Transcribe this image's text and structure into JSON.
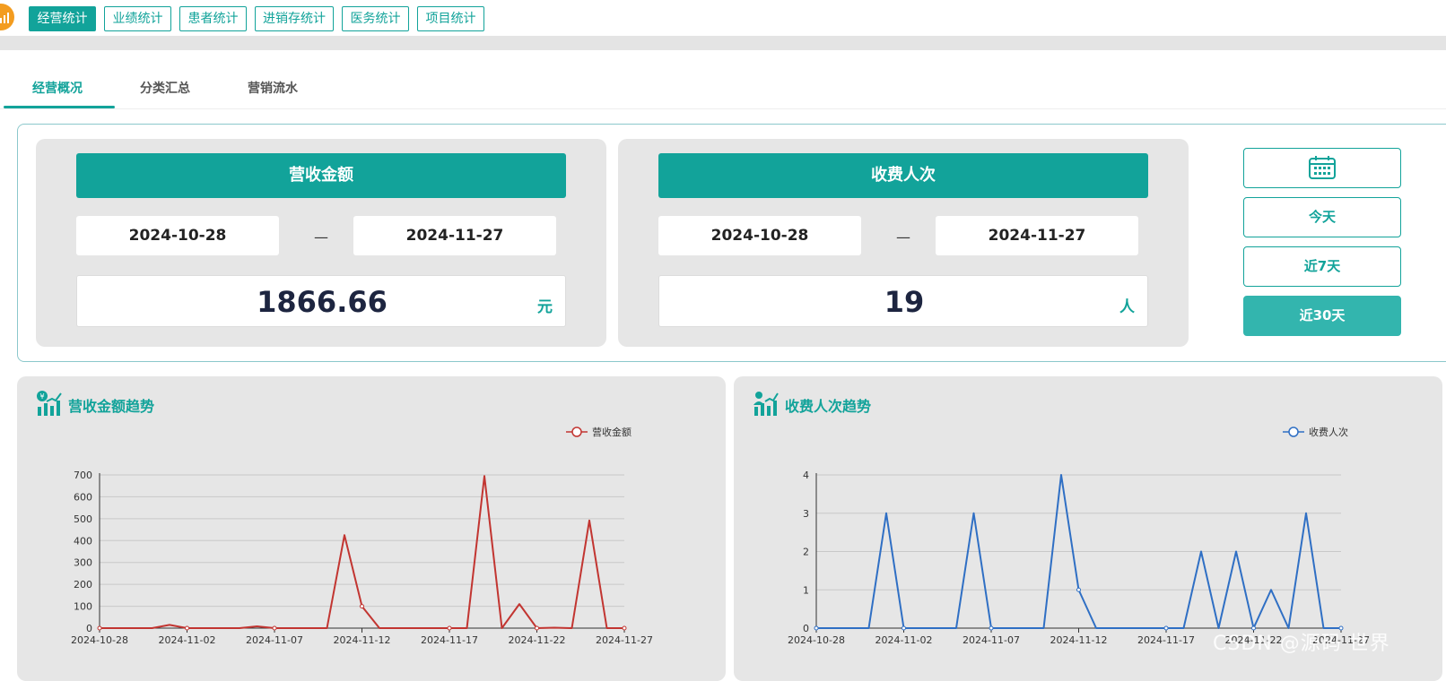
{
  "top_tabs": [
    "经营统计",
    "业绩统计",
    "患者统计",
    "进销存统计",
    "医务统计",
    "项目统计"
  ],
  "sub_tabs": [
    "经营概况",
    "分类汇总",
    "营销流水"
  ],
  "revenue_card": {
    "title": "营收金额",
    "start_date": "2024-10-28",
    "end_date": "2024-11-27",
    "separator": "—",
    "value": "1866.66",
    "unit": "元"
  },
  "visits_card": {
    "title": "收费人次",
    "start_date": "2024-10-28",
    "end_date": "2024-11-27",
    "separator": "—",
    "value": "19",
    "unit": "人"
  },
  "range_buttons": {
    "calendar_icon": "calendar-icon",
    "today": "今天",
    "last7": "近7天",
    "last30": "近30天"
  },
  "revenue_chart_title": "营收金额趋势",
  "visits_chart_title": "收费人次趋势",
  "watermark": "CSDN @源码 世界",
  "colors": {
    "accent": "#12a39a",
    "revenue_line": "#c23531",
    "visits_line": "#2f6fc4"
  },
  "chart_data": [
    {
      "type": "line",
      "legend": "营收金额",
      "legend_position": "top-right",
      "x_ticks": [
        "2024-10-28",
        "2024-11-02",
        "2024-11-07",
        "2024-11-12",
        "2024-11-17",
        "2024-11-22",
        "2024-11-27"
      ],
      "y_ticks": [
        0,
        100,
        200,
        300,
        400,
        500,
        600,
        700
      ],
      "ylim": [
        0,
        700
      ],
      "grid": true,
      "series": [
        {
          "name": "营收金额",
          "x": [
            "2024-10-28",
            "2024-10-29",
            "2024-10-30",
            "2024-10-31",
            "2024-11-01",
            "2024-11-02",
            "2024-11-03",
            "2024-11-04",
            "2024-11-05",
            "2024-11-06",
            "2024-11-07",
            "2024-11-08",
            "2024-11-09",
            "2024-11-10",
            "2024-11-11",
            "2024-11-12",
            "2024-11-13",
            "2024-11-14",
            "2024-11-15",
            "2024-11-16",
            "2024-11-17",
            "2024-11-18",
            "2024-11-19",
            "2024-11-20",
            "2024-11-21",
            "2024-11-22",
            "2024-11-23",
            "2024-11-24",
            "2024-11-25",
            "2024-11-26",
            "2024-11-27"
          ],
          "values": [
            0,
            0,
            0,
            0,
            15,
            0,
            0,
            0,
            0,
            8,
            0,
            0,
            0,
            0,
            425,
            100,
            0,
            0,
            0,
            0,
            0,
            0,
            695,
            0,
            110,
            0,
            2,
            0,
            492,
            0,
            0
          ]
        }
      ]
    },
    {
      "type": "line",
      "legend": "收费人次",
      "legend_position": "top-right",
      "x_ticks": [
        "2024-10-28",
        "2024-11-02",
        "2024-11-07",
        "2024-11-12",
        "2024-11-17",
        "2024-11-22",
        "2024-11-27"
      ],
      "y_ticks": [
        0,
        1,
        2,
        3,
        4
      ],
      "ylim": [
        0,
        4
      ],
      "grid": true,
      "series": [
        {
          "name": "收费人次",
          "x": [
            "2024-10-28",
            "2024-10-29",
            "2024-10-30",
            "2024-10-31",
            "2024-11-01",
            "2024-11-02",
            "2024-11-03",
            "2024-11-04",
            "2024-11-05",
            "2024-11-06",
            "2024-11-07",
            "2024-11-08",
            "2024-11-09",
            "2024-11-10",
            "2024-11-11",
            "2024-11-12",
            "2024-11-13",
            "2024-11-14",
            "2024-11-15",
            "2024-11-16",
            "2024-11-17",
            "2024-11-18",
            "2024-11-19",
            "2024-11-20",
            "2024-11-21",
            "2024-11-22",
            "2024-11-23",
            "2024-11-24",
            "2024-11-25",
            "2024-11-26",
            "2024-11-27"
          ],
          "values": [
            0,
            0,
            0,
            0,
            3,
            0,
            0,
            0,
            0,
            3,
            0,
            0,
            0,
            0,
            4,
            1,
            0,
            0,
            0,
            0,
            0,
            0,
            2,
            0,
            2,
            0,
            1,
            0,
            3,
            0,
            0
          ]
        }
      ]
    }
  ]
}
